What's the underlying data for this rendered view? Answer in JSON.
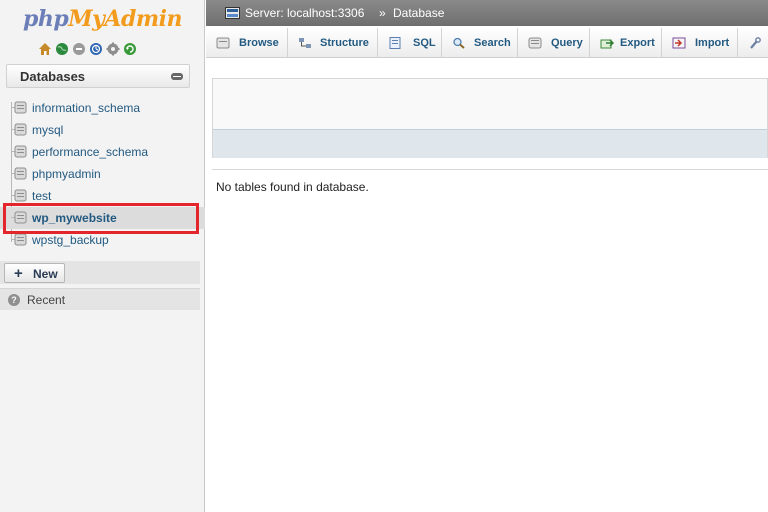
{
  "logo": {
    "part1": "php",
    "part2": "MyAdmin"
  },
  "quick_icons": [
    {
      "name": "home-icon",
      "color": "#c78a2b"
    },
    {
      "name": "globe-icon",
      "color": "#2c8a3e"
    },
    {
      "name": "logout-icon",
      "color": "#9a9a9a"
    },
    {
      "name": "docs-icon",
      "color": "#2f67b3"
    },
    {
      "name": "settings-icon",
      "color": "#8e8e8e"
    },
    {
      "name": "reload-icon",
      "color": "#3a9a3a"
    }
  ],
  "sidebar": {
    "header": "Databases",
    "databases": [
      {
        "name": "information_schema",
        "selected": false
      },
      {
        "name": "mysql",
        "selected": false
      },
      {
        "name": "performance_schema",
        "selected": false
      },
      {
        "name": "phpmyadmin",
        "selected": false
      },
      {
        "name": "test",
        "selected": false
      },
      {
        "name": "wp_mywebsite",
        "selected": true
      },
      {
        "name": "wpstg_backup",
        "selected": false
      }
    ],
    "new_label": "New",
    "recent_label": "Recent"
  },
  "breadcrumb": {
    "server": "Server: localhost:3306",
    "separator": "»",
    "database": "Database"
  },
  "tabs": [
    {
      "label": "Browse",
      "icon": "browse-icon"
    },
    {
      "label": "Structure",
      "icon": "structure-icon"
    },
    {
      "label": "SQL",
      "icon": "sql-icon"
    },
    {
      "label": "Search",
      "icon": "search-icon"
    },
    {
      "label": "Query",
      "icon": "query-icon"
    },
    {
      "label": "Export",
      "icon": "export-icon"
    },
    {
      "label": "Import",
      "icon": "import-icon"
    },
    {
      "label": "",
      "icon": "wrench-icon"
    }
  ],
  "main": {
    "message": "No tables found in database."
  },
  "colors": {
    "link": "#235a81",
    "highlight": "#e3262b",
    "topbar": "#7a7a7a"
  }
}
